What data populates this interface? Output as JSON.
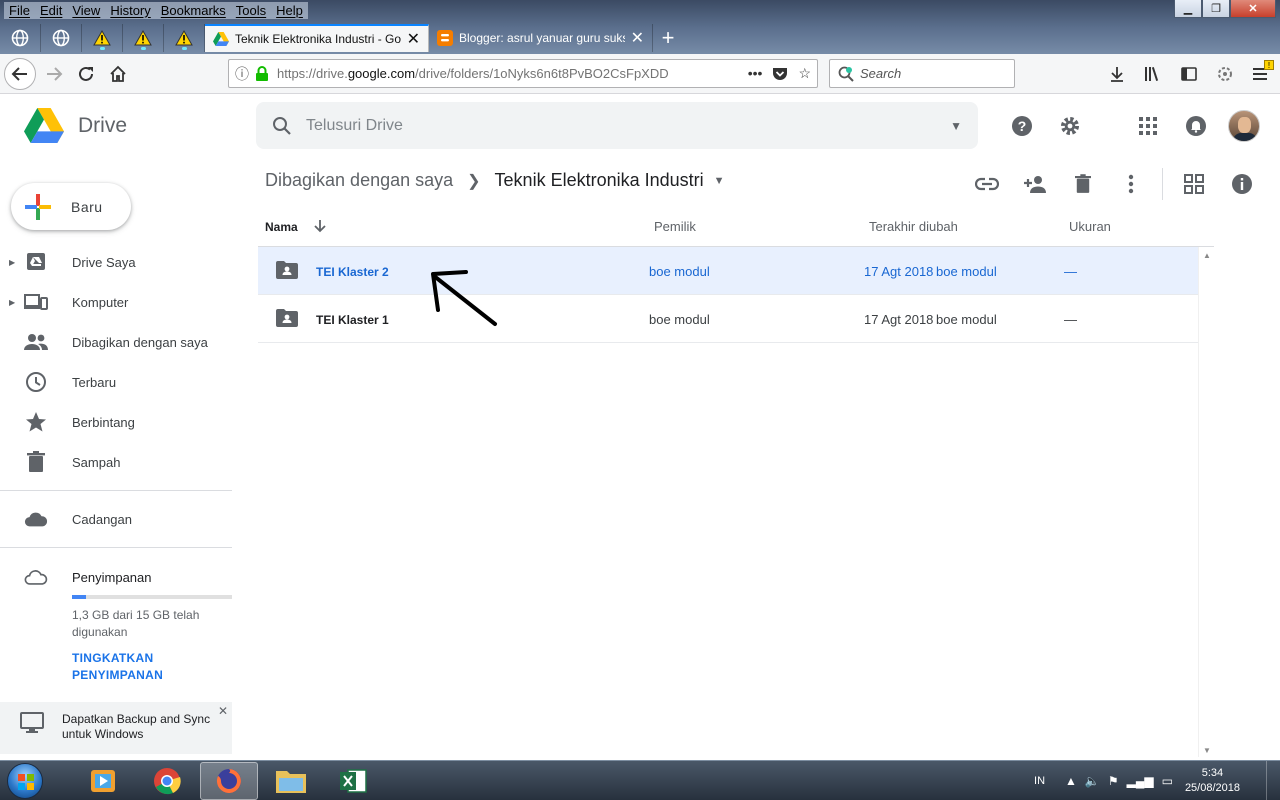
{
  "browser": {
    "menu": [
      "File",
      "Edit",
      "View",
      "History",
      "Bookmarks",
      "Tools",
      "Help"
    ],
    "tabs": [
      {
        "title": "Teknik Elektronika Industri - Google Drive",
        "active": true
      },
      {
        "title": "Blogger: asrul yanuar guru sukses",
        "active": false
      }
    ],
    "url": {
      "prefix": "https://drive.",
      "domain": "google.com",
      "path": "/drive/folders/1oNyks6n6t8PvBO2CsFpXDD"
    },
    "search_placeholder": "Search"
  },
  "drive": {
    "logo": "Drive",
    "search_placeholder": "Telusuri Drive",
    "new_button": "Baru"
  },
  "sidebar": {
    "items": [
      {
        "label": "Drive Saya",
        "icon": "drive-icon",
        "expandable": true
      },
      {
        "label": "Komputer",
        "icon": "computer-icon",
        "expandable": true
      },
      {
        "label": "Dibagikan dengan saya",
        "icon": "people-icon",
        "expandable": false
      },
      {
        "label": "Terbaru",
        "icon": "clock-icon",
        "expandable": false
      },
      {
        "label": "Berbintang",
        "icon": "star-icon",
        "expandable": false
      },
      {
        "label": "Sampah",
        "icon": "trash-icon",
        "expandable": false
      }
    ],
    "backup": "Cadangan",
    "storage": {
      "label": "Penyimpanan",
      "used_fraction": 0.087,
      "text": "1,3 GB dari 15 GB telah digunakan",
      "upgrade": "TINGKATKAN PENYIMPANAN"
    },
    "promo": "Dapatkan Backup and Sync untuk Windows"
  },
  "breadcrumb": {
    "parent": "Dibagikan dengan saya",
    "current": "Teknik Elektronika Industri"
  },
  "list": {
    "columns": {
      "name": "Nama",
      "owner": "Pemilik",
      "modified": "Terakhir diubah",
      "size": "Ukuran"
    },
    "rows": [
      {
        "name": "TEI Klaster 2",
        "owner": "boe modul",
        "modified_date": "17 Agt 2018",
        "modified_by": "boe modul",
        "size": "—",
        "selected": true
      },
      {
        "name": "TEI Klaster 1",
        "owner": "boe modul",
        "modified_date": "17 Agt 2018",
        "modified_by": "boe modul",
        "size": "—",
        "selected": false
      }
    ]
  },
  "taskbar": {
    "lang": "IN",
    "time": "5:34",
    "date": "25/08/2018"
  },
  "colors": {
    "selected_row_bg": "#e8f0fe",
    "selected_text": "#1967d2",
    "accent_blue": "#1a73e8"
  }
}
